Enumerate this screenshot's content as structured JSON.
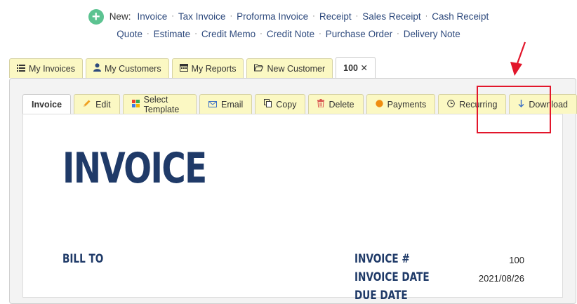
{
  "new_bar": {
    "label": "New:",
    "row1": [
      "Invoice",
      "Tax Invoice",
      "Proforma Invoice",
      "Receipt",
      "Sales Receipt",
      "Cash Receipt"
    ],
    "row2": [
      "Quote",
      "Estimate",
      "Credit Memo",
      "Credit Note",
      "Purchase Order",
      "Delivery Note"
    ]
  },
  "top_tabs": [
    {
      "label": "My Invoices",
      "icon": "list-icon"
    },
    {
      "label": "My Customers",
      "icon": "user-icon"
    },
    {
      "label": "My Reports",
      "icon": "calendar-icon"
    },
    {
      "label": "New Customer",
      "icon": "folder-open-icon"
    },
    {
      "label": "100 ✕",
      "icon": ""
    }
  ],
  "sub_tabs": [
    {
      "label": "Invoice",
      "icon": ""
    },
    {
      "label": "Edit",
      "icon": "pencil-icon"
    },
    {
      "label": "Select Template",
      "icon": "template-grid-icon"
    },
    {
      "label": "Email",
      "icon": "envelope-icon"
    },
    {
      "label": "Copy",
      "icon": "copy-icon"
    },
    {
      "label": "Delete",
      "icon": "trash-icon"
    },
    {
      "label": "Payments",
      "icon": "coin-icon"
    },
    {
      "label": "Recurring",
      "icon": "clock-icon"
    },
    {
      "label": "Download",
      "icon": "arrow-down-icon"
    }
  ],
  "document": {
    "title": "INVOICE",
    "bill_to": "BILL TO",
    "invoice_no_label": "INVOICE #",
    "invoice_no": "100",
    "invoice_date_label": "INVOICE DATE",
    "invoice_date": "2021/08/26",
    "due_date_label": "DUE DATE"
  },
  "colors": {
    "accent_green": "#5cc391",
    "link_blue": "#2e4a7d",
    "tab_yellow": "#fbf8c3",
    "doc_navy": "#1f3a68",
    "highlight_red": "#e2162b"
  }
}
